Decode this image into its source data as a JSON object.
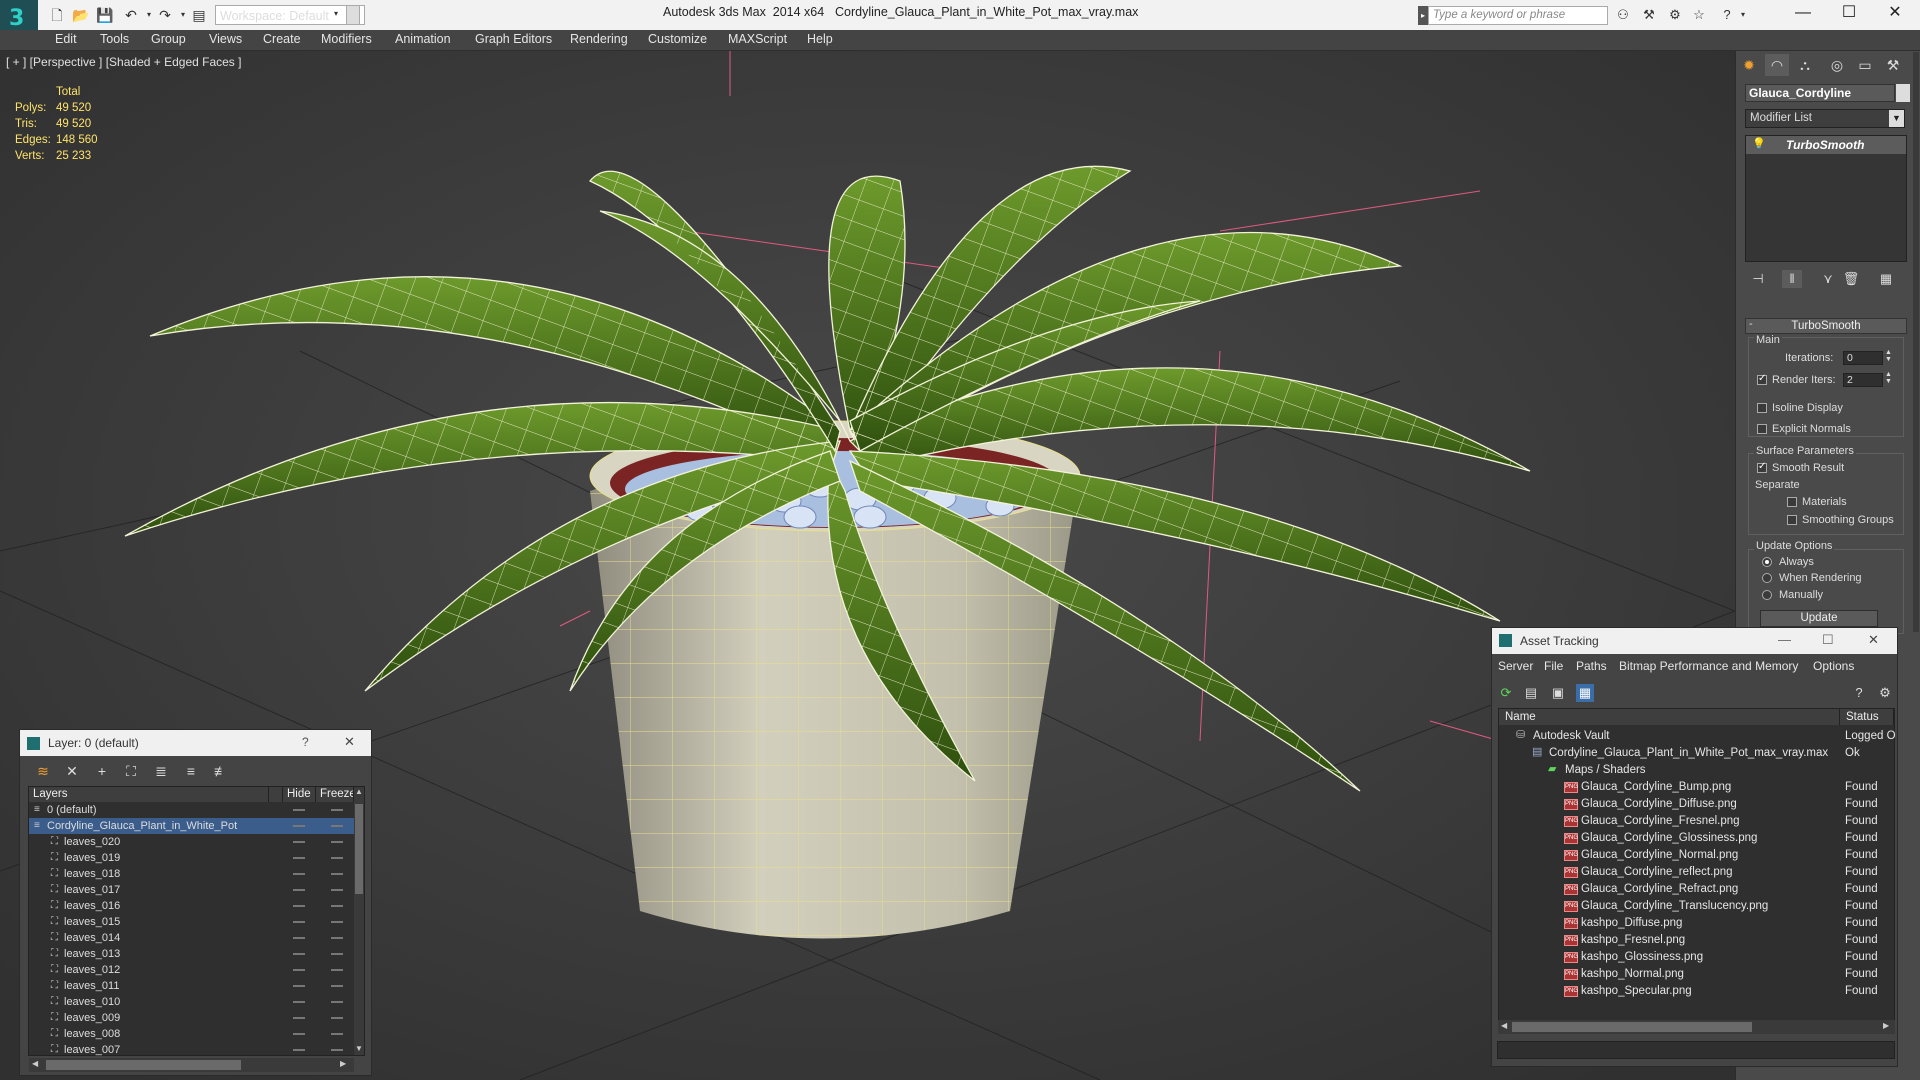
{
  "titlebar": {
    "workspace": "Workspace: Default",
    "app_title": "Autodesk 3ds Max  2014 x64",
    "doc_title": "Cordyline_Glauca_Plant_in_White_Pot_max_vray.max",
    "search_placeholder": "Type a keyword or phrase",
    "minimize": "—",
    "maximize": "☐",
    "close": "✕"
  },
  "menu": [
    "Edit",
    "Tools",
    "Group",
    "Views",
    "Create",
    "Modifiers",
    "Animation",
    "Graph Editors",
    "Rendering",
    "Customize",
    "MAXScript",
    "Help"
  ],
  "viewport": {
    "label": "[ + ] [Perspective ] [Shaded + Edged Faces ]",
    "stats": {
      "header": "Total",
      "rows": [
        {
          "label": "Polys:",
          "value": "49 520"
        },
        {
          "label": "Tris:",
          "value": "49 520"
        },
        {
          "label": "Edges:",
          "value": "148 560"
        },
        {
          "label": "Verts:",
          "value": "25 233"
        }
      ]
    }
  },
  "command_panel": {
    "object_name": "Glauca_Cordyline",
    "modifier_list": "Modifier List",
    "stack_item": "TurboSmooth",
    "rollout_title": "TurboSmooth",
    "collapse": "-",
    "main_group": "Main",
    "iterations_label": "Iterations:",
    "iterations_value": "0",
    "render_iters_label": "Render Iters:",
    "render_iters_value": "2",
    "isoline": "Isoline Display",
    "explicit_normals": "Explicit Normals",
    "surface_group": "Surface Parameters",
    "smooth_result": "Smooth Result",
    "separate": "Separate",
    "materials": "Materials",
    "smoothing_groups": "Smoothing Groups",
    "update_group": "Update Options",
    "always": "Always",
    "when_rendering": "When Rendering",
    "manually": "Manually",
    "update_button": "Update"
  },
  "layer_panel": {
    "title": "Layer: 0 (default)",
    "help": "?",
    "close": "✕",
    "columns": [
      "Layers",
      "Hide",
      "Freeze"
    ],
    "rows": [
      {
        "name": "0 (default)",
        "indent": 0,
        "selected": false
      },
      {
        "name": "Cordyline_Glauca_Plant_in_White_Pot",
        "indent": 0,
        "selected": true
      },
      {
        "name": "leaves_020",
        "indent": 1,
        "selected": false
      },
      {
        "name": "leaves_019",
        "indent": 1,
        "selected": false
      },
      {
        "name": "leaves_018",
        "indent": 1,
        "selected": false
      },
      {
        "name": "leaves_017",
        "indent": 1,
        "selected": false
      },
      {
        "name": "leaves_016",
        "indent": 1,
        "selected": false
      },
      {
        "name": "leaves_015",
        "indent": 1,
        "selected": false
      },
      {
        "name": "leaves_014",
        "indent": 1,
        "selected": false
      },
      {
        "name": "leaves_013",
        "indent": 1,
        "selected": false
      },
      {
        "name": "leaves_012",
        "indent": 1,
        "selected": false
      },
      {
        "name": "leaves_011",
        "indent": 1,
        "selected": false
      },
      {
        "name": "leaves_010",
        "indent": 1,
        "selected": false
      },
      {
        "name": "leaves_009",
        "indent": 1,
        "selected": false
      },
      {
        "name": "leaves_008",
        "indent": 1,
        "selected": false
      },
      {
        "name": "leaves_007",
        "indent": 1,
        "selected": false
      }
    ]
  },
  "asset_tracking": {
    "title": "Asset Tracking",
    "minimize": "—",
    "maximize": "☐",
    "close": "✕",
    "menu": [
      "Server",
      "File",
      "Paths",
      "Bitmap Performance and Memory",
      "Options"
    ],
    "columns": [
      "Name",
      "Status"
    ],
    "rows": [
      {
        "name": "Autodesk Vault",
        "indent": 0,
        "status": "Logged O",
        "icon": "vault"
      },
      {
        "name": "Cordyline_Glauca_Plant_in_White_Pot_max_vray.max",
        "indent": 1,
        "status": "Ok",
        "icon": "max"
      },
      {
        "name": "Maps / Shaders",
        "indent": 2,
        "status": "",
        "icon": "folder"
      },
      {
        "name": "Glauca_Cordyline_Bump.png",
        "indent": 3,
        "status": "Found",
        "icon": "png"
      },
      {
        "name": "Glauca_Cordyline_Diffuse.png",
        "indent": 3,
        "status": "Found",
        "icon": "png"
      },
      {
        "name": "Glauca_Cordyline_Fresnel.png",
        "indent": 3,
        "status": "Found",
        "icon": "png"
      },
      {
        "name": "Glauca_Cordyline_Glossiness.png",
        "indent": 3,
        "status": "Found",
        "icon": "png"
      },
      {
        "name": "Glauca_Cordyline_Normal.png",
        "indent": 3,
        "status": "Found",
        "icon": "png"
      },
      {
        "name": "Glauca_Cordyline_reflect.png",
        "indent": 3,
        "status": "Found",
        "icon": "png"
      },
      {
        "name": "Glauca_Cordyline_Refract.png",
        "indent": 3,
        "status": "Found",
        "icon": "png"
      },
      {
        "name": "Glauca_Cordyline_Translucency.png",
        "indent": 3,
        "status": "Found",
        "icon": "png"
      },
      {
        "name": "kashpo_Diffuse.png",
        "indent": 3,
        "status": "Found",
        "icon": "png"
      },
      {
        "name": "kashpo_Fresnel.png",
        "indent": 3,
        "status": "Found",
        "icon": "png"
      },
      {
        "name": "kashpo_Glossiness.png",
        "indent": 3,
        "status": "Found",
        "icon": "png"
      },
      {
        "name": "kashpo_Normal.png",
        "indent": 3,
        "status": "Found",
        "icon": "png"
      },
      {
        "name": "kashpo_Specular.png",
        "indent": 3,
        "status": "Found",
        "icon": "png"
      }
    ]
  },
  "colors": {
    "selection": "#3a5d8c",
    "stats_text": "#ffe36a",
    "leaf": "#4d7a1c",
    "pot": "#c9c6b3"
  }
}
